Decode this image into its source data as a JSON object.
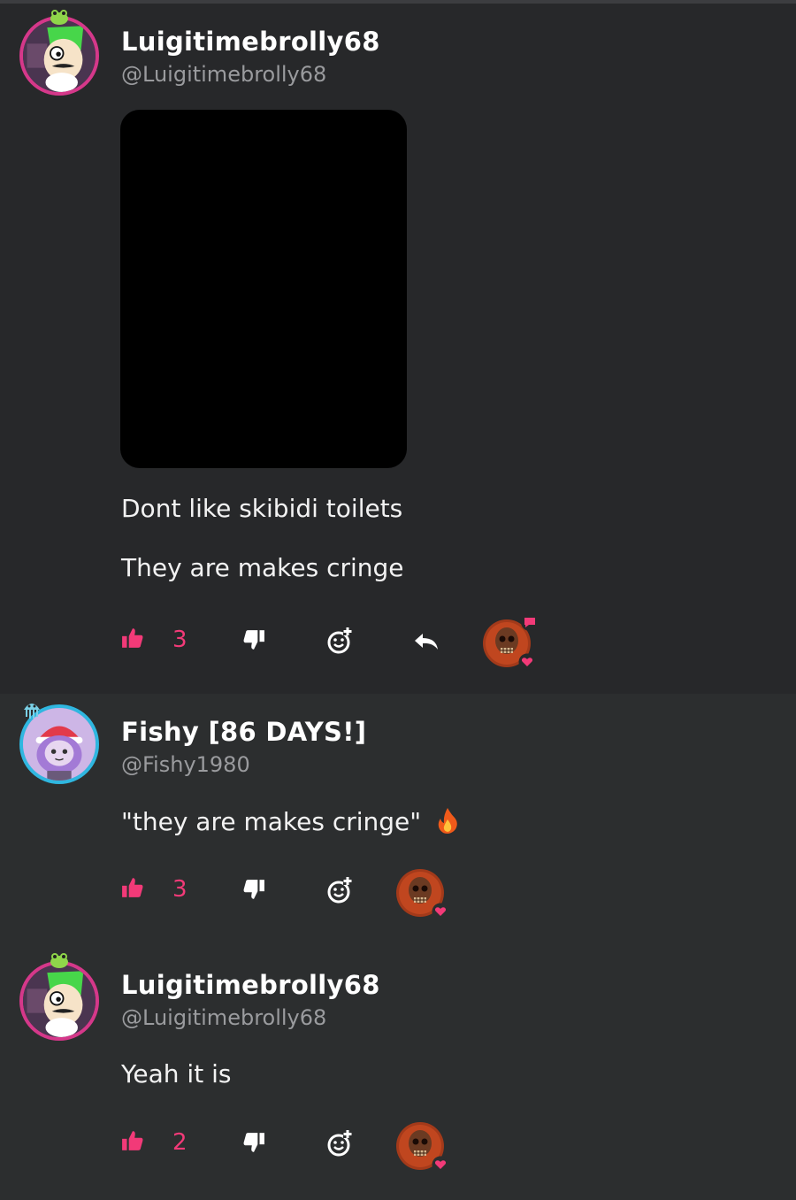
{
  "comments": [
    {
      "username": "Luigitimebrolly68",
      "handle": "@Luigitimebrolly68",
      "has_media": true,
      "lines": [
        "Dont like skibidi toilets",
        "They are makes cringe"
      ],
      "likes": "3",
      "has_reply": true
    },
    {
      "username": "Fishy [86 DAYS!]",
      "handle": "@Fishy1980",
      "lines": [
        "\"they are makes cringe\""
      ],
      "emoji": "fire",
      "likes": "3"
    },
    {
      "username": "Luigitimebrolly68",
      "handle": "@Luigitimebrolly68",
      "lines": [
        "Yeah it is"
      ],
      "likes": "2"
    }
  ],
  "colors": {
    "accent": "#f23a78",
    "background": "#2a2b2d",
    "luigi_ring": "#d5388a",
    "fishy_ring": "#2fb7e0"
  },
  "icons": [
    "thumbs-up-icon",
    "thumbs-down-icon",
    "add-reaction-icon",
    "reply-icon",
    "reaction-avatar"
  ]
}
